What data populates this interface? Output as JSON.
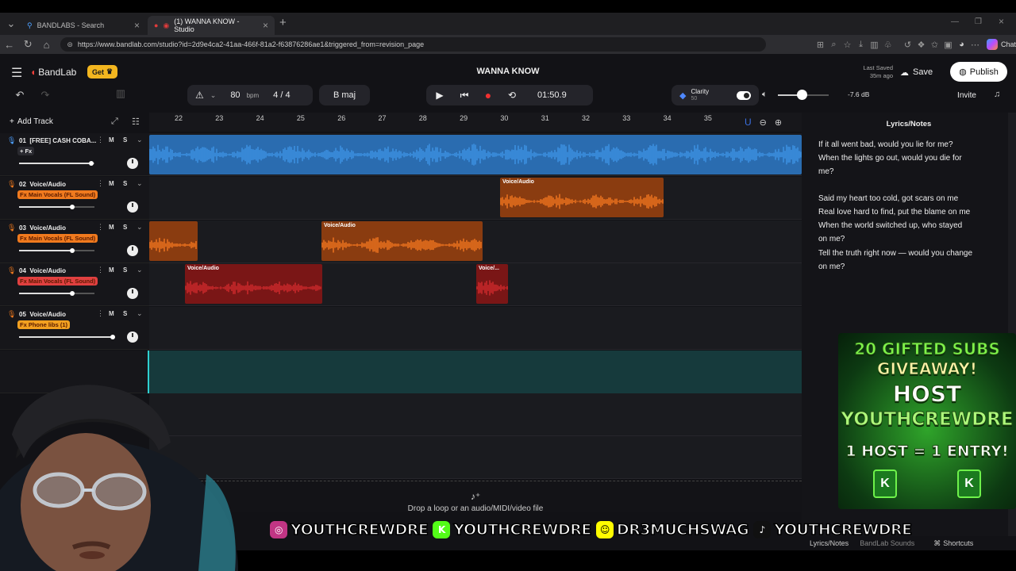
{
  "browser": {
    "tabs": [
      {
        "title": "BANDLABS - Search"
      },
      {
        "title": "(1) WANNA KNOW - Studio"
      }
    ],
    "url": "https://www.bandlab.com/studio?id=2d9e4ca2-41aa-466f-81a2-f63876286ae1&triggered_from=revision_page",
    "chat_label": "Chat"
  },
  "app": {
    "brand": "BandLab",
    "get_label": "Get",
    "project_title": "WANNA KNOW",
    "last_saved_label": "Last Saved",
    "last_saved_time": "35m ago",
    "save_label": "Save",
    "publish_label": "Publish",
    "invite_label": "Invite"
  },
  "transport": {
    "bpm": "80",
    "bpm_unit": "bpm",
    "time_sig_num": "4",
    "time_sig_sep": "/",
    "time_sig_den": "4",
    "key": "B maj",
    "time": "01:50.9",
    "clarity_label": "Clarity",
    "clarity_value": "50",
    "volume_db": "-7.6 dB"
  },
  "tracks_header": {
    "add_track_label": "Add Track"
  },
  "ruler": [
    "22",
    "23",
    "24",
    "25",
    "26",
    "27",
    "28",
    "29",
    "30",
    "31",
    "32",
    "33",
    "34",
    "35"
  ],
  "tracks": [
    {
      "num": "01",
      "name": "[FREE] CASH COBA...",
      "fx": "+ Fx"
    },
    {
      "num": "02",
      "name": "Voice/Audio",
      "fx": "Fx Main Vocals (FL Sound)"
    },
    {
      "num": "03",
      "name": "Voice/Audio",
      "fx": "Fx Main Vocals (FL Sound)"
    },
    {
      "num": "04",
      "name": "Voice/Audio",
      "fx": "Fx Main Vocals (FL Sound)"
    },
    {
      "num": "05",
      "name": "Voice/Audio",
      "fx": "Fx Phone libs (1)"
    }
  ],
  "mute_label": "M",
  "solo_label": "S",
  "clips": [
    {
      "label": "Voice/Audio"
    },
    {
      "label": "Voice/Audio"
    },
    {
      "label": "Voice/Audio"
    },
    {
      "label": "Voice/..."
    },
    {
      "label": "Voice/Au..."
    },
    {
      "label": "Voice/Audio"
    }
  ],
  "drop_hint": "Drop a loop or an audio/MIDI/video file",
  "lyrics": {
    "title": "Lyrics/Notes",
    "lines": [
      "If it all went bad, would you lie for me?",
      "When the lights go out, would you die for",
      "me?",
      "Said my heart too cold, got scars on me",
      "Real love hard to find, put the blame on me",
      "When the world switched up, who stayed",
      "on me?",
      "Tell the truth right now — would you change",
      "on me?"
    ]
  },
  "bottom_tabs": {
    "lyrics": "Lyrics/Notes",
    "sounds": "BandLab Sounds",
    "shortcuts": "Shortcuts"
  },
  "promo": {
    "line1": "20 GIFTED SUBS",
    "line2": "GIVEAWAY!",
    "line3": "HOST",
    "line4": "YOUTHCREWDRE",
    "line5": "1 HOST = 1 ENTRY!"
  },
  "socials": [
    {
      "icon": "instagram-icon",
      "handle": "YOUTHCREWDRE",
      "color": "#c13584"
    },
    {
      "icon": "kick-icon",
      "handle": "YOUTHCREWDRE",
      "color": "#53fc18"
    },
    {
      "icon": "snapchat-icon",
      "handle": "DR3MUCHSWAG",
      "color": "#fffc00"
    },
    {
      "icon": "tiktok-icon",
      "handle": "YOUTHCREWDRE",
      "color": "#111111"
    }
  ],
  "colors": {
    "blue_clip": "#3b8fe0",
    "orange_clip": "#e8701e",
    "red_clip": "#c8282a",
    "green_clip": "#34c88a",
    "publish_bg": "#ffffff",
    "get_bg": "#f3b61f"
  }
}
